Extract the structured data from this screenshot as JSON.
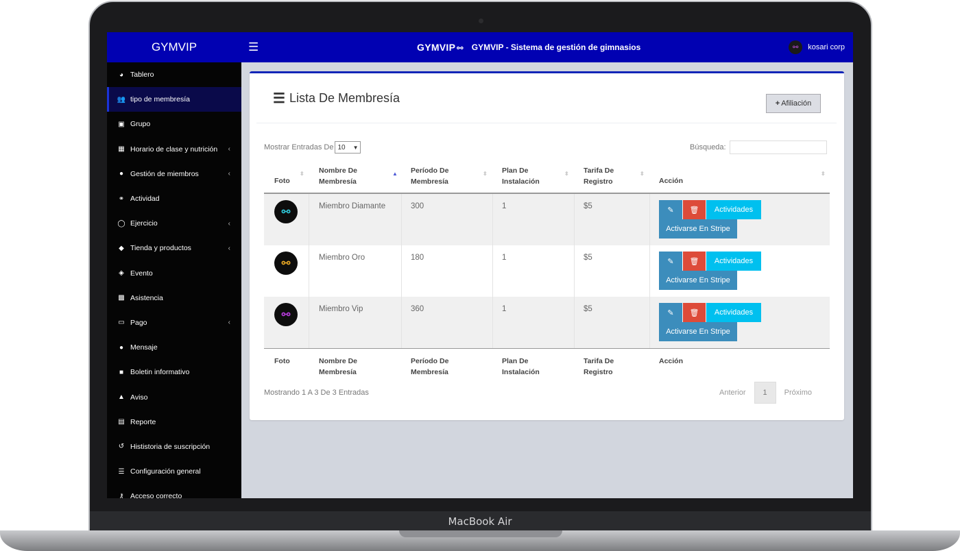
{
  "device": {
    "brand_label": "MacBook Air"
  },
  "topbar": {
    "brand": "GYMVIP",
    "menu_icon": "hamburger-icon",
    "logo_text": "GYMVIP",
    "logo_icon": "dumbbell-icon",
    "system_title": "GYMVIP - Sistema de gestión de gimnasios",
    "user_name": "kosari corp",
    "bar_color": "#0101b2"
  },
  "sidebar": {
    "items": [
      {
        "label": "Tablero",
        "icon": "pie-chart-icon",
        "glyph": "◕",
        "submenu": false
      },
      {
        "label": "tipo de membresía",
        "icon": "users-icon",
        "glyph": "👥",
        "submenu": false,
        "active": true
      },
      {
        "label": "Grupo",
        "icon": "group-icon",
        "glyph": "▣",
        "submenu": false
      },
      {
        "label": "Horario de clase y nutrición",
        "icon": "calendar-icon",
        "glyph": "▦",
        "submenu": true
      },
      {
        "label": "Gestión de miembros",
        "icon": "user-icon",
        "glyph": "●",
        "submenu": true
      },
      {
        "label": "Actividad",
        "icon": "bicycle-icon",
        "glyph": "⚭",
        "submenu": false
      },
      {
        "label": "Ejercicio",
        "icon": "exercise-icon",
        "glyph": "◯",
        "submenu": true
      },
      {
        "label": "Tienda y productos",
        "icon": "tags-icon",
        "glyph": "◆",
        "submenu": true
      },
      {
        "label": "Evento",
        "icon": "ticket-icon",
        "glyph": "◈",
        "submenu": false
      },
      {
        "label": "Asistencia",
        "icon": "attendance-icon",
        "glyph": "▩",
        "submenu": false
      },
      {
        "label": "Pago",
        "icon": "money-icon",
        "glyph": "▭",
        "submenu": true
      },
      {
        "label": "Mensaje",
        "icon": "comment-icon",
        "glyph": "●",
        "submenu": false
      },
      {
        "label": "Boletin informativo",
        "icon": "newsletter-icon",
        "glyph": "■",
        "submenu": false
      },
      {
        "label": "Aviso",
        "icon": "bell-icon",
        "glyph": "▲",
        "submenu": false
      },
      {
        "label": "Reporte",
        "icon": "report-icon",
        "glyph": "▤",
        "submenu": false
      },
      {
        "label": "Hististoria de suscripción",
        "icon": "history-icon",
        "glyph": "↺",
        "submenu": false
      },
      {
        "label": "Configuración general",
        "icon": "sliders-icon",
        "glyph": "☰",
        "submenu": false
      },
      {
        "label": "Acceso correcto",
        "icon": "key-icon",
        "glyph": "⚷",
        "submenu": false
      }
    ]
  },
  "main": {
    "title": "Lista De Membresía",
    "add_button": "Afiliación",
    "entries_prefix": "Mostrar Entradas De",
    "entries_value": "10",
    "search_label": "Búsqueda:",
    "columns": [
      {
        "line1": "Foto",
        "line2": ""
      },
      {
        "line1": "Nombre De",
        "line2": "Membresía"
      },
      {
        "line1": "Período De",
        "line2": "Membresía"
      },
      {
        "line1": "Plan De",
        "line2": "Instalación"
      },
      {
        "line1": "Tarifa De",
        "line2": "Registro"
      },
      {
        "line1": "Acción",
        "line2": ""
      }
    ],
    "rows": [
      {
        "name": "Miembro Diamante",
        "period": "300",
        "plan": "1",
        "fee": "$5",
        "icon_color": "#2ec5d6"
      },
      {
        "name": "Miembro Oro",
        "period": "180",
        "plan": "1",
        "fee": "$5",
        "icon_color": "#e5a524"
      },
      {
        "name": "Miembro Vip",
        "period": "360",
        "plan": "1",
        "fee": "$5",
        "icon_color": "#b43ad8"
      }
    ],
    "action_labels": {
      "edit_icon": "edit-icon",
      "delete_icon": "trash-icon",
      "activities": "Actividades",
      "stripe": "Activarse En Stripe"
    },
    "showing_text": "Mostrando 1 A 3 De 3 Entradas",
    "pagination": {
      "prev": "Anterior",
      "current": "1",
      "next": "Próximo"
    }
  }
}
